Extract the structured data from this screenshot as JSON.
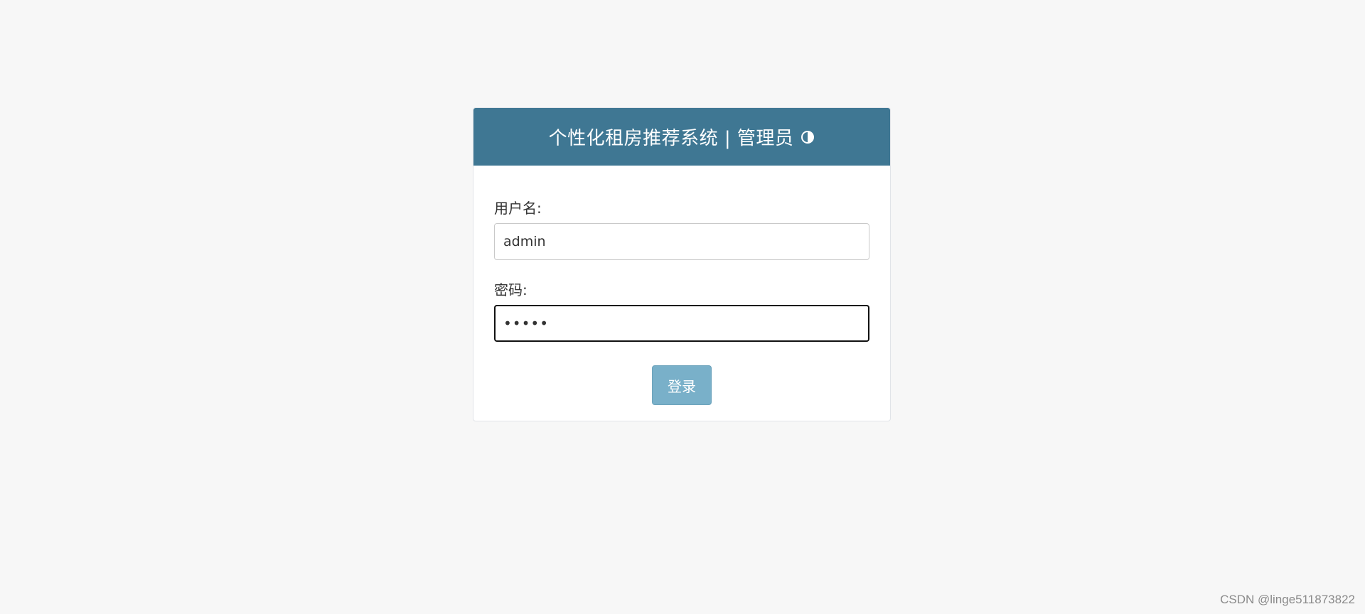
{
  "header": {
    "title": "个性化租房推荐系统 | 管理员",
    "icon": "contrast-icon"
  },
  "form": {
    "username_label": "用户名:",
    "username_value": "admin",
    "password_label": "密码:",
    "password_value": "•••••"
  },
  "actions": {
    "login_label": "登录"
  },
  "watermark": "CSDN @linge511873822",
  "colors": {
    "page_background": "#f7f7f7",
    "header_background": "#3f7793",
    "button_background": "#79b0c9"
  }
}
